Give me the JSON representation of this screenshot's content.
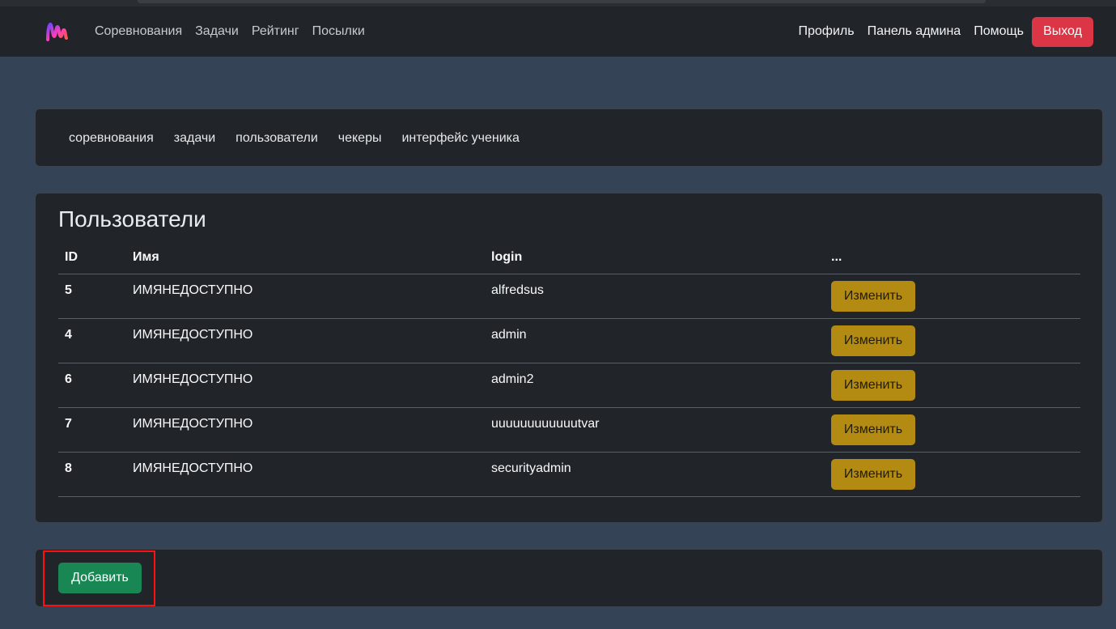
{
  "navbar": {
    "left_links": [
      "Соревнования",
      "Задачи",
      "Рейтинг",
      "Посылки"
    ],
    "right_links": [
      "Профиль",
      "Панель админа",
      "Помощь"
    ],
    "logout_label": "Выход"
  },
  "admin_nav": {
    "links": [
      "соревнования",
      "задачи",
      "пользователи",
      "чекеры",
      "интерфейс ученика"
    ]
  },
  "users": {
    "title": "Пользователи",
    "columns": [
      "ID",
      "Имя",
      "login",
      "..."
    ],
    "rows": [
      {
        "id": "5",
        "name": "ИМЯНЕДОСТУПНО",
        "login": "alfredsus",
        "action": "Изменить"
      },
      {
        "id": "4",
        "name": "ИМЯНЕДОСТУПНО",
        "login": "admin",
        "action": "Изменить"
      },
      {
        "id": "6",
        "name": "ИМЯНЕДОСТУПНО",
        "login": "admin2",
        "action": "Изменить"
      },
      {
        "id": "7",
        "name": "ИМЯНЕДОСТУПНО",
        "login": "uuuuuuuuuuuutvar",
        "action": "Изменить"
      },
      {
        "id": "8",
        "name": "ИМЯНЕДОСТУПНО",
        "login": "securityadmin",
        "action": "Изменить"
      }
    ]
  },
  "add_label": "Добавить",
  "colors": {
    "logout": "#dc3545",
    "edit": "#b48b12",
    "add": "#198754",
    "highlight": "#ff1010",
    "background": "#344355",
    "card": "#212529"
  },
  "icons": {
    "logo": "brand-logo"
  }
}
